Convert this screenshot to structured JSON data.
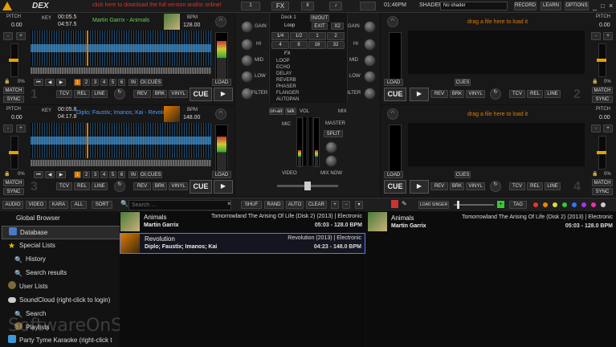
{
  "app": {
    "logo": "DEX",
    "notice": "click here to download the full version and/or online!",
    "tabs": {
      "fx": "FX",
      "pause": "II",
      "jog": "1",
      "vol": "♪"
    },
    "time": "01:46PM",
    "shader_label": "SHADER",
    "shader_value": "No shader",
    "record": "RECORD",
    "learn": "LEARN",
    "options": "OPTIONS"
  },
  "deck1": {
    "pitch_label": "PITCH",
    "pitch_value": "0.00",
    "key_label": "KEY",
    "elapsed": "00:05.5",
    "remain": "04:57.5",
    "title": "Martin Garrix - Animals",
    "bpm_label": "BPM",
    "bpm": "128.00",
    "number": "1",
    "match": "MATCH",
    "sync": "SYNC",
    "load": "LOAD",
    "cues": "CUES",
    "in": "IN",
    "out": "OUT",
    "tcv": "TCV",
    "rel": "REL",
    "line": "LINE",
    "rev": "REV",
    "brk": "BRK",
    "vinyl": "VINYL",
    "cue": "CUE",
    "pct": "0%",
    "hotcues": [
      "1",
      "2",
      "3",
      "4",
      "5",
      "6"
    ]
  },
  "deck2": {
    "pitch_label": "PITCH",
    "pitch_value": "0.00",
    "number": "2",
    "drag": "drag a file here to load it",
    "match": "MATCH",
    "sync": "SYNC",
    "load": "LOAD",
    "cues": "CUES",
    "tcv": "TCV",
    "rel": "REL",
    "line": "LINE",
    "rev": "REV",
    "brk": "BRK",
    "vinyl": "VINYL",
    "cue": "CUE",
    "pct": "0%"
  },
  "deck3": {
    "pitch_label": "PITCH",
    "pitch_value": "0.00",
    "key_label": "KEY",
    "elapsed": "00:05.8",
    "remain": "04:17.8",
    "title": "Diplo; Faustix; Imanos; Kai - Revolution",
    "bpm_label": "BPM",
    "bpm": "148.00",
    "number": "3",
    "match": "MATCH",
    "sync": "SYNC",
    "load": "LOAD",
    "cues": "CUES",
    "in": "IN",
    "out": "OUT",
    "tcv": "TCV",
    "rel": "REL",
    "line": "LINE",
    "rev": "REV",
    "brk": "BRK",
    "vinyl": "VINYL",
    "cue": "CUE",
    "pct": "0%",
    "hotcues": [
      "1",
      "2",
      "3",
      "4",
      "5",
      "6"
    ]
  },
  "deck4": {
    "pitch_label": "PITCH",
    "pitch_value": "0.00",
    "number": "4",
    "drag": "drag a file here to load it",
    "match": "MATCH",
    "sync": "SYNC",
    "load": "LOAD",
    "cues": "CUES",
    "tcv": "TCV",
    "rel": "REL",
    "line": "LINE",
    "rev": "REV",
    "brk": "BRK",
    "vinyl": "VINYL",
    "cue": "CUE",
    "pct": "0%"
  },
  "mixer": {
    "gain": "GAIN",
    "hi": "HI",
    "mid": "MID",
    "low": "LOW",
    "filter": "FILTER",
    "deck_label": "Deck 1",
    "deck_mode": "Loop",
    "in_out": "IN/OUT",
    "exit": "EXIT",
    "x2": "X2",
    "loops": [
      "1/4",
      "1/2",
      "1",
      "2",
      "4",
      "8",
      "16",
      "32"
    ],
    "fx": "FX",
    "fx_list": [
      "LOOP",
      "ECHO",
      "DELAY",
      "REVERB",
      "PHASER",
      "FLANGER",
      "AUTOPAN"
    ],
    "on_air": "on-air",
    "talk": "talk",
    "vol": "VOL",
    "mix": "MIX",
    "master": "MASTER",
    "split": "SPLIT",
    "mic": "MIC",
    "video": "VIDEO",
    "mix_now": "MIX NOW"
  },
  "browser_bar": {
    "audio": "AUDIO",
    "video": "VIDEO",
    "kara": "KARA",
    "all": "ALL",
    "sort": "SORT",
    "search_placeholder": "Search ...",
    "shuf": "SHUF",
    "rand": "RAND",
    "auto": "AUTO",
    "clear": "CLEAR",
    "load_singer": "LOAD SINGER",
    "tag": "TAG"
  },
  "sidebar": {
    "title": "Global Browser",
    "items": [
      "Database",
      "Special Lists",
      "History",
      "Search results",
      "User Lists",
      "SoundCloud (right-click to login)",
      "Search",
      "Playlists",
      "Party Tyme Karaoke (right-click t"
    ]
  },
  "tracks": [
    {
      "title": "Animals",
      "artist": "Martin Garrix",
      "album": "Tomorrowland The Arising Of Life (Disk 2) (2013) | Electronic",
      "meta": "05:03 - 128.0 BPM"
    },
    {
      "title": "Revolution",
      "artist": "Diplo; Faustix; Imanos; Kai",
      "album": "Revolution (2013) | Electronic",
      "meta": "04:23 - 148.0 BPM"
    }
  ],
  "preview": {
    "title": "Animals",
    "artist": "Martin Garrix",
    "album": "Tomorrowland The Arising Of Life (Disk 2) (2013) | Electronic",
    "meta": "05:03 - 128.0 BPM"
  },
  "watermark": "SoftwareOnSale",
  "colors": {
    "accent_orange": "#e07b00",
    "wave_blue": "#4aa3e6",
    "title_green": "#64d05a",
    "link_blue": "#4f9cff",
    "notice_red": "#e03030"
  }
}
